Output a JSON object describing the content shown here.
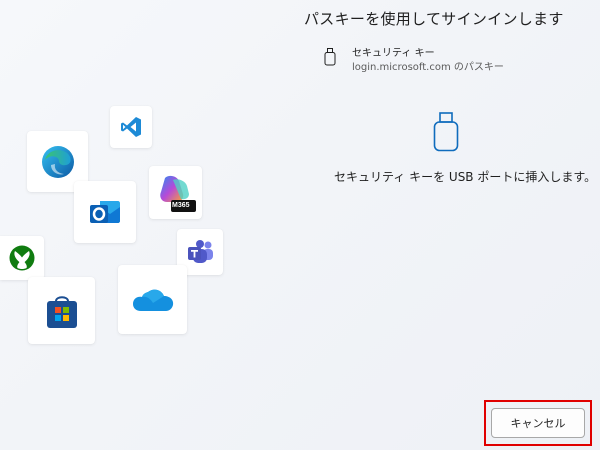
{
  "header": {
    "title": "パスキーを使用してサインインします"
  },
  "device": {
    "name": "セキュリティ キー",
    "site": "login.microsoft.com のパスキー",
    "icon": "usb-key-icon"
  },
  "instruction": {
    "text": "セキュリティ キーを USB ポートに挿入します。"
  },
  "buttons": {
    "cancel_label": "キャンセル"
  },
  "app_icons": {
    "m365_label": "M365",
    "items": [
      "vscode-icon",
      "edge-icon",
      "copilot-m365-icon",
      "outlook-icon",
      "teams-icon",
      "xbox-icon",
      "store-icon",
      "onedrive-icon"
    ]
  },
  "colors": {
    "highlight": "#e00000",
    "accent": "#0f6cbd"
  }
}
